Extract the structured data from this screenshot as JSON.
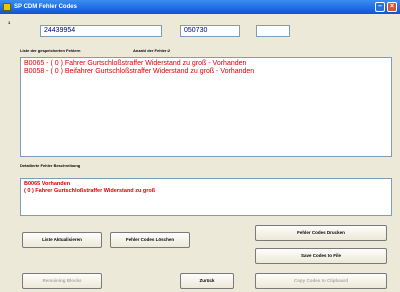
{
  "window": {
    "title": "SP CDM Fehler Codes"
  },
  "header": {
    "index_label": "1",
    "field1": "24439954",
    "field2": "050730",
    "field3": ""
  },
  "labels": {
    "stored_errors": "Liste der gespeicherten Fehlern",
    "error_count": "Anzahl der Fehler:2",
    "detailed": "Detailierte Fehler Beschreibung"
  },
  "error_list": [
    "B0065 - ( 0 )  Fahrer Gurtschloßstraffer Widerstand zu groß - Vorhanden",
    "B0058 - ( 0 )  Beifahrer Gurtschloßstraffer Widerstand zu groß - Vorhanden"
  ],
  "description": [
    "B0065  Vorhanden",
    "( 0 )  Fahrer Gurtschloßstraffer Widerstand zu groß"
  ],
  "buttons": {
    "refresh": "Liste Aktualisieren",
    "delete": "Fehler Codes Löschen",
    "print": "Fehler Codes Drucken",
    "save": "Save Codes to File",
    "blocks": "Remaining Blocks",
    "back": "Zurück",
    "clipboard": "Copy Codes to Clipboard"
  }
}
